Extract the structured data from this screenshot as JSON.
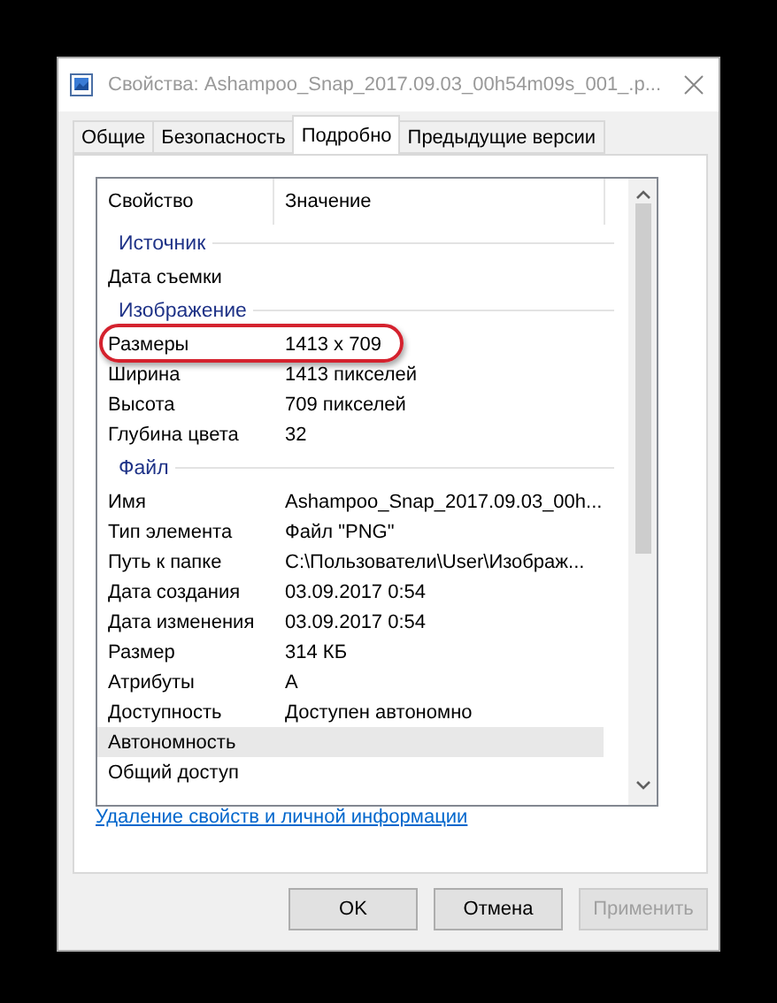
{
  "window": {
    "title": "Свойства: Ashampoo_Snap_2017.09.03_00h54m09s_001_.p..."
  },
  "tabs": [
    {
      "label": "Общие",
      "selected": false
    },
    {
      "label": "Безопасность",
      "selected": false
    },
    {
      "label": "Подробно",
      "selected": true
    },
    {
      "label": "Предыдущие версии",
      "selected": false
    }
  ],
  "table": {
    "columns": [
      "Свойство",
      "Значение"
    ],
    "rows": [
      {
        "kind": "section",
        "label": "Источник"
      },
      {
        "kind": "row",
        "property": "Дата съемки",
        "value": "",
        "selected": false,
        "highlighted": false
      },
      {
        "kind": "section",
        "label": "Изображение"
      },
      {
        "kind": "row",
        "property": "Размеры",
        "value": "1413 x 709",
        "selected": false,
        "highlighted": true
      },
      {
        "kind": "row",
        "property": "Ширина",
        "value": "1413 пикселей",
        "selected": false,
        "highlighted": false
      },
      {
        "kind": "row",
        "property": "Высота",
        "value": "709 пикселей",
        "selected": false,
        "highlighted": false
      },
      {
        "kind": "row",
        "property": "Глубина цвета",
        "value": "32",
        "selected": false,
        "highlighted": false
      },
      {
        "kind": "section",
        "label": "Файл"
      },
      {
        "kind": "row",
        "property": "Имя",
        "value": "Ashampoo_Snap_2017.09.03_00h...",
        "selected": false,
        "highlighted": false
      },
      {
        "kind": "row",
        "property": "Тип элемента",
        "value": "Файл \"PNG\"",
        "selected": false,
        "highlighted": false
      },
      {
        "kind": "row",
        "property": "Путь к папке",
        "value": "C:\\Пользователи\\User\\Изображ...",
        "selected": false,
        "highlighted": false
      },
      {
        "kind": "row",
        "property": "Дата создания",
        "value": "03.09.2017 0:54",
        "selected": false,
        "highlighted": false
      },
      {
        "kind": "row",
        "property": "Дата изменения",
        "value": "03.09.2017 0:54",
        "selected": false,
        "highlighted": false
      },
      {
        "kind": "row",
        "property": "Размер",
        "value": "314 КБ",
        "selected": false,
        "highlighted": false
      },
      {
        "kind": "row",
        "property": "Атрибуты",
        "value": "A",
        "selected": false,
        "highlighted": false
      },
      {
        "kind": "row",
        "property": "Доступность",
        "value": "Доступен автономно",
        "selected": false,
        "highlighted": false
      },
      {
        "kind": "row",
        "property": "Автономность",
        "value": "",
        "selected": true,
        "highlighted": false
      },
      {
        "kind": "row",
        "property": "Общий доступ",
        "value": "",
        "selected": false,
        "highlighted": false
      }
    ]
  },
  "link": "Удаление свойств и личной информации",
  "buttons": [
    {
      "label": "OK",
      "disabled": false
    },
    {
      "label": "Отмена",
      "disabled": false
    },
    {
      "label": "Применить",
      "disabled": true
    }
  ]
}
